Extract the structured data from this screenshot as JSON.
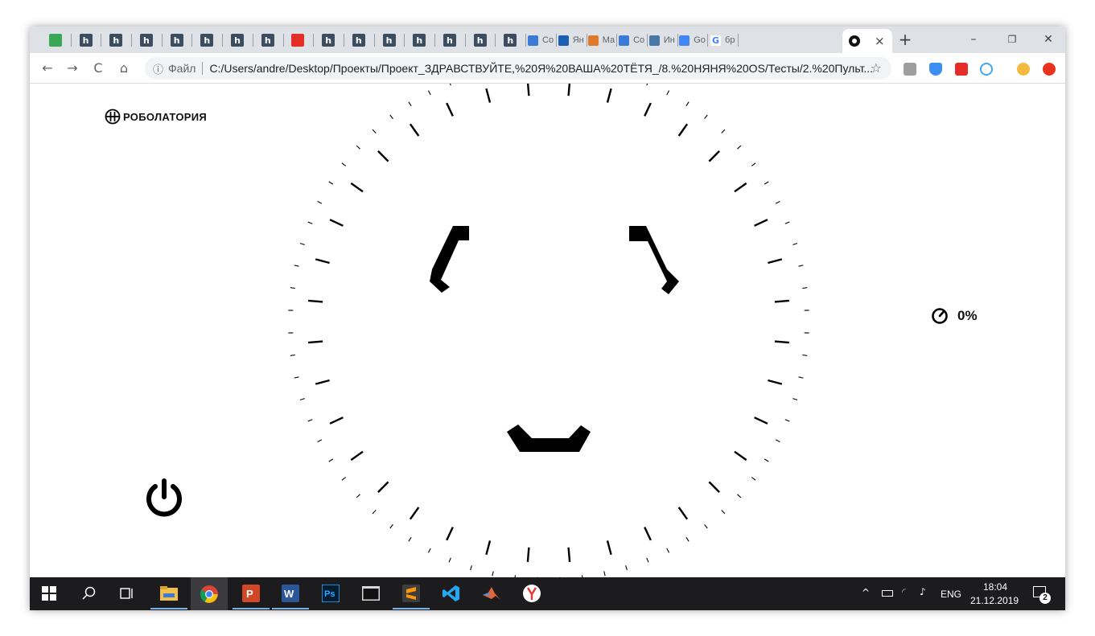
{
  "browser": {
    "tabs": [
      {
        "icon": "green-pause-icon",
        "title": ""
      },
      {
        "icon": "h-icon",
        "title": "h"
      },
      {
        "icon": "h-icon",
        "title": "h"
      },
      {
        "icon": "h-icon",
        "title": "h"
      },
      {
        "icon": "h-icon",
        "title": "h"
      },
      {
        "icon": "h-icon",
        "title": "h"
      },
      {
        "icon": "h-icon",
        "title": "h"
      },
      {
        "icon": "h-icon",
        "title": "h"
      },
      {
        "icon": "youtube-icon",
        "title": ""
      },
      {
        "icon": "h-icon",
        "title": "h"
      },
      {
        "icon": "h-icon",
        "title": "h"
      },
      {
        "icon": "h-icon",
        "title": "h"
      },
      {
        "icon": "h-icon",
        "title": "h"
      },
      {
        "icon": "h-icon",
        "title": "h"
      },
      {
        "icon": "h-icon",
        "title": "h"
      },
      {
        "icon": "h-icon",
        "title": "h"
      },
      {
        "icon": "chat-icon",
        "title": "Co"
      },
      {
        "icon": "yandex-icon",
        "title": "Ян"
      },
      {
        "icon": "star-icon",
        "title": "Ma"
      },
      {
        "icon": "chat-icon",
        "title": "Co"
      },
      {
        "icon": "vk-icon",
        "title": "Ин"
      },
      {
        "icon": "translate-icon",
        "title": "Go"
      },
      {
        "icon": "google-icon",
        "title": "бр"
      }
    ],
    "active_tab_close": "×",
    "new_tab": "+",
    "window_controls": {
      "minimize": "–",
      "restore": "❐",
      "close": "✕"
    },
    "nav": {
      "back": "←",
      "forward": "→",
      "reload": "C",
      "home": "⌂"
    },
    "address": {
      "info_icon": "ⓘ",
      "scheme_label": "Файл",
      "url": "C:/Users/andre/Desktop/Проекты/Проект_ЗДРАВСТВУЙТЕ,%20Я%20ВАША%20ТЁТЯ_/8.%20НЯНЯ%20OS/Тесты/2.%20Пульт...",
      "bookmark_star": "☆"
    }
  },
  "app": {
    "logo_text": "РОБОЛАТОРИЯ",
    "speed_value": "0%"
  },
  "taskbar": {
    "language": "ENG",
    "time": "18:04",
    "date": "21.12.2019",
    "notifications": "2"
  },
  "colors": {
    "tabstrip": "#dee1e6",
    "taskbar": "#1c1c1f",
    "ink": "#000000"
  }
}
